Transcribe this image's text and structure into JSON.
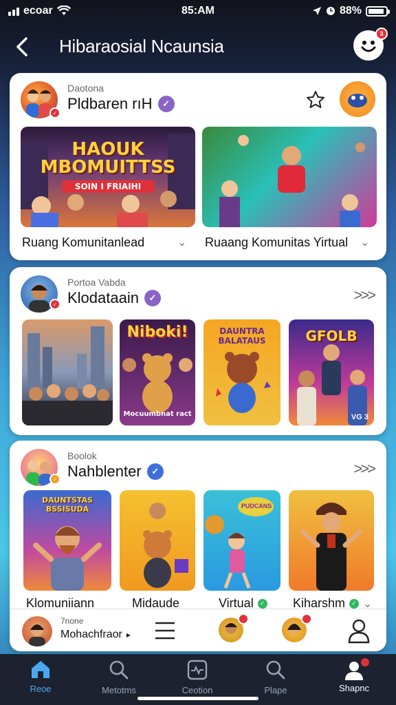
{
  "status_bar": {
    "carrier": "ecoar",
    "time": "85:AM",
    "battery": "88%"
  },
  "header": {
    "title": "Hibaraosial Ncaunsia",
    "badge_count": "3"
  },
  "sections": [
    {
      "subtitle": "Daotona",
      "title": "Pldbaren rıH",
      "verify_color": "#8a63c7",
      "thumbs": [
        {
          "overlay": "HAOUK MBOMUITTSS",
          "overlay2": "SOIN I FRIAIHI",
          "caption": "Ruang Komunitanlead"
        },
        {
          "overlay": "",
          "overlay2": "",
          "caption": "Ruaang Komunitas Yirtual"
        }
      ]
    },
    {
      "subtitle": "Portoa Vabda",
      "title": "Klodataain",
      "verify_color": "#8a63c7",
      "thumbs": [
        {
          "overlay": ""
        },
        {
          "overlay": "Niboki!",
          "bottom": "Mocuumbnat ract"
        },
        {
          "overlay": "DAUNTRA BALATAUS"
        },
        {
          "overlay": "GFOLB",
          "bottom": "VG 3"
        }
      ]
    },
    {
      "subtitle": "Boolok",
      "title": "Nahblenter",
      "verify_color": "#3f6fd9",
      "thumbs": [
        {
          "overlay": "DAUNTSTAS BSSISUDA",
          "caption": "Klomuniiann"
        },
        {
          "overlay": "",
          "caption": "Midaude"
        },
        {
          "overlay": "PUDCANS",
          "caption": "Virtual"
        },
        {
          "overlay": "",
          "caption": "Kiharshm"
        }
      ]
    }
  ],
  "mini_player": {
    "subtitle": "7none",
    "title": "Mohachfraor"
  },
  "bottom_nav": [
    {
      "label": "Reoe",
      "icon": "home-icon",
      "active": true
    },
    {
      "label": "Metotms",
      "icon": "search-icon",
      "active": false
    },
    {
      "label": "Ceotion",
      "icon": "activity-icon",
      "active": false
    },
    {
      "label": "Plape",
      "icon": "search-icon",
      "active": false
    },
    {
      "label": "Shapnc",
      "icon": "profile-icon",
      "active": false
    }
  ],
  "colors": {
    "accent": "#3b9be8",
    "notification": "#e0313a",
    "card_bg": "#ffffff"
  }
}
